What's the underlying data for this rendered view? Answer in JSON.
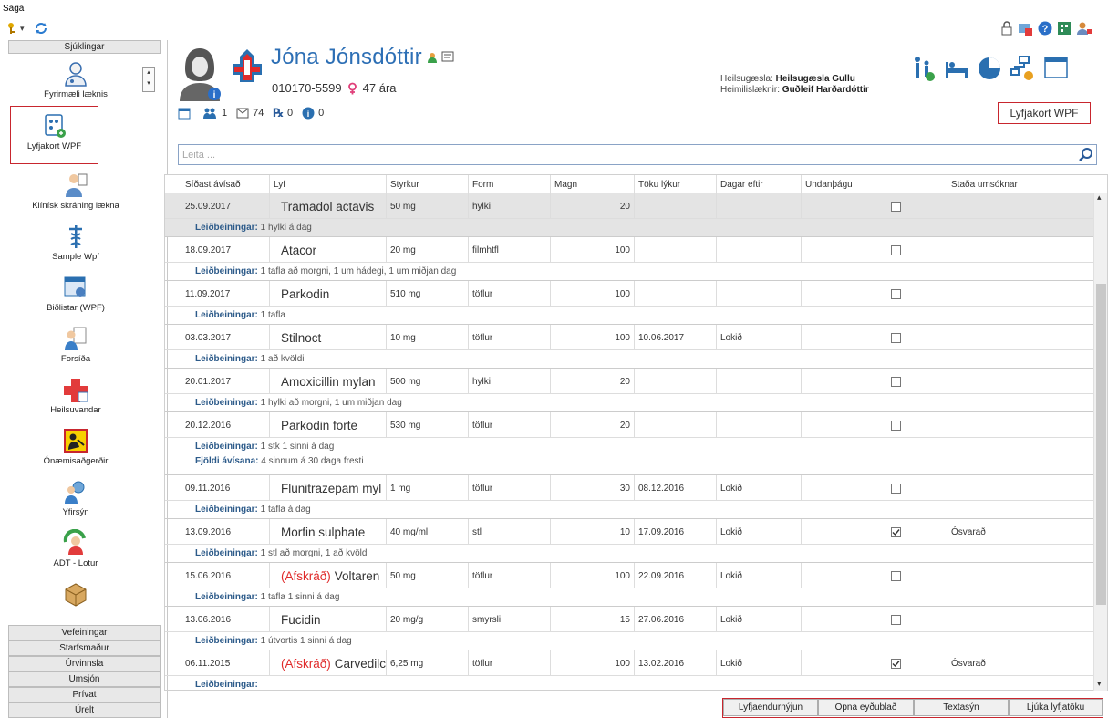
{
  "app": {
    "title": "Saga"
  },
  "sidebar": {
    "top_header": "Sjúklingar",
    "items": [
      {
        "label": "Fyrirmæli læknis",
        "icon": "doctor-icon"
      },
      {
        "label": "Lyfjakort WPF",
        "icon": "pill-card-icon",
        "selected": true
      },
      {
        "label": "Klínísk skráning lækna",
        "icon": "doctor-notes-icon"
      },
      {
        "label": "Sample Wpf",
        "icon": "caduceus-icon"
      },
      {
        "label": "Biðlistar (WPF)",
        "icon": "calendar-people-icon"
      },
      {
        "label": "Forsíða",
        "icon": "person-document-icon"
      },
      {
        "label": "Heilsuvandar",
        "icon": "health-cross-icon"
      },
      {
        "label": "Ónæmisaðgerðir",
        "icon": "vaccination-icon"
      },
      {
        "label": "Yfirsýn",
        "icon": "overview-icon"
      },
      {
        "label": "ADT - Lotur",
        "icon": "adt-icon"
      },
      {
        "label": "",
        "icon": "box-icon"
      }
    ],
    "bottom_headers": [
      "Vefeiningar",
      "Starfsmaður",
      "Úrvinnsla",
      "Umsjón",
      "Prívat",
      "Úrelt"
    ]
  },
  "patient": {
    "name": "Jóna Jónsdóttir",
    "id": "010170-5599",
    "age": "47 ára",
    "clinic_label": "Heilsugæsla:",
    "clinic": "Heilsugæsla Gullu",
    "gp_label": "Heimilislæknir:",
    "gp": "Guðleif Harðardóttir",
    "counts": {
      "people": "1",
      "messages": "74",
      "rx": "0",
      "info": "0"
    },
    "view_badge": "Lyfjakort WPF"
  },
  "search": {
    "placeholder": "Leita ..."
  },
  "grid": {
    "columns": [
      "Síðast ávísað",
      "Lyf",
      "Styrkur",
      "Form",
      "Magn",
      "Töku lýkur",
      "Dagar eftir",
      "Undanþágu",
      "Staða umsóknar"
    ],
    "instr_label": "Leiðbeiningar:",
    "rows": [
      {
        "date": "25.09.2017",
        "lyf": "Tramadol actavis",
        "strength": "50 mg",
        "form": "hylki",
        "qty": "20",
        "ends": "",
        "days": "",
        "exempt": false,
        "status": "",
        "instr": "1 hylki á dag",
        "selected": true,
        "extra": ""
      },
      {
        "date": "18.09.2017",
        "lyf": "Atacor",
        "strength": "20 mg",
        "form": "filmhtfl",
        "qty": "100",
        "ends": "",
        "days": "",
        "exempt": false,
        "status": "",
        "instr": "1 tafla að morgni, 1 um hádegi, 1 um miðjan dag",
        "extra": ""
      },
      {
        "date": "11.09.2017",
        "lyf": "Parkodin",
        "strength": "510 mg",
        "form": "töflur",
        "qty": "100",
        "ends": "",
        "days": "",
        "exempt": false,
        "status": "",
        "instr": "1 tafla",
        "extra": ""
      },
      {
        "date": "03.03.2017",
        "lyf": "Stilnoct",
        "strength": "10 mg",
        "form": "töflur",
        "qty": "100",
        "ends": "10.06.2017",
        "days": "Lokið",
        "exempt": false,
        "status": "",
        "instr": "1 að kvöldi",
        "extra": ""
      },
      {
        "date": "20.01.2017",
        "lyf": "Amoxicillin mylan",
        "strength": "500 mg",
        "form": "hylki",
        "qty": "20",
        "ends": "",
        "days": "",
        "exempt": false,
        "status": "",
        "instr": "1 hylki að morgni, 1 um miðjan dag",
        "extra": ""
      },
      {
        "date": "20.12.2016",
        "lyf": "Parkodin forte",
        "strength": "530 mg",
        "form": "töflur",
        "qty": "20",
        "ends": "",
        "days": "",
        "exempt": false,
        "status": "",
        "instr": "1 stk 1 sinni á dag",
        "extra_label": "Fjöldi ávísana:",
        "extra": "4 sinnum á 30 daga fresti"
      },
      {
        "date": "09.11.2016",
        "lyf": "Flunitrazepam myl",
        "strength": "1 mg",
        "form": "töflur",
        "qty": "30",
        "ends": "08.12.2016",
        "days": "Lokið",
        "exempt": false,
        "status": "",
        "instr": "1 tafla á dag",
        "extra": ""
      },
      {
        "date": "13.09.2016",
        "lyf": "Morfin sulphate",
        "strength": "40 mg/ml",
        "form": "stl",
        "qty": "10",
        "ends": "17.09.2016",
        "days": "Lokið",
        "exempt": true,
        "status": "Ósvarað",
        "instr": "1 stl að morgni, 1 að kvöldi",
        "extra": ""
      },
      {
        "date": "15.06.2016",
        "prefix": "(Afskráð)",
        "lyf": "Voltaren",
        "strength": "50 mg",
        "form": "töflur",
        "qty": "100",
        "ends": "22.09.2016",
        "days": "Lokið",
        "exempt": false,
        "status": "",
        "instr": "1 tafla 1 sinni á dag",
        "extra": ""
      },
      {
        "date": "13.06.2016",
        "lyf": "Fucidin",
        "strength": "20 mg/g",
        "form": "smyrsli",
        "qty": "15",
        "ends": "27.06.2016",
        "days": "Lokið",
        "exempt": false,
        "status": "",
        "instr": "1 útvortis 1 sinni á dag",
        "extra": ""
      },
      {
        "date": "06.11.2015",
        "prefix": "(Afskráð)",
        "lyf": "Carvedilc",
        "strength": "6,25 mg",
        "form": "töflur",
        "qty": "100",
        "ends": "13.02.2016",
        "days": "Lokið",
        "exempt": true,
        "status": "Ósvarað",
        "instr": "",
        "extra": ""
      }
    ]
  },
  "footer": {
    "buttons": [
      "Lyfjaendurnýjun",
      "Opna eyðublað",
      "Textasýn",
      "Ljúka lyfjatöku"
    ]
  },
  "colors": {
    "accent_red": "#c8262e",
    "name_blue": "#2d6fb5",
    "afskrad_red": "#e02a2a"
  }
}
